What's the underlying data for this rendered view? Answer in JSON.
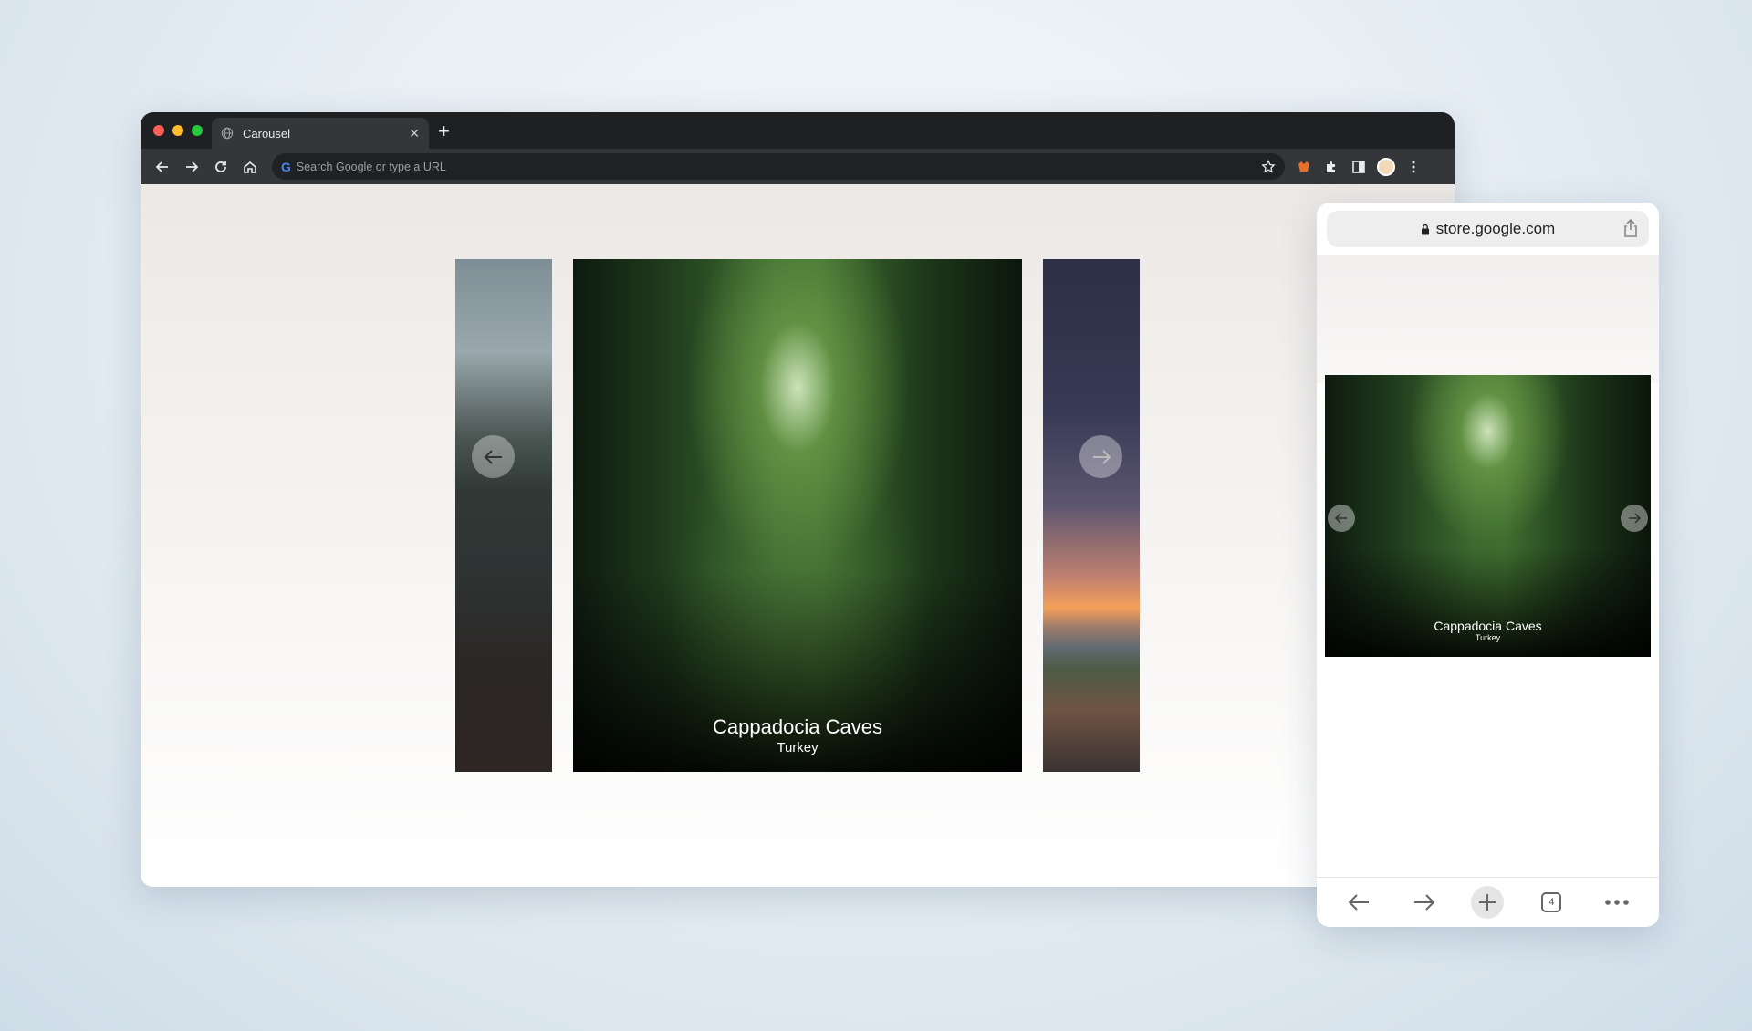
{
  "desktop": {
    "tab": {
      "title": "Carousel"
    },
    "omnibox": {
      "placeholder": "Search Google or type a URL"
    },
    "carousel": {
      "active_slide": {
        "title": "Cappadocia Caves",
        "subtitle": "Turkey"
      }
    }
  },
  "mobile": {
    "url": "store.google.com",
    "carousel": {
      "active_slide": {
        "title": "Cappadocia Caves",
        "subtitle": "Turkey"
      }
    },
    "tab_count": "4"
  },
  "colors": {
    "titlebar": "#1f2022",
    "toolbar": "#35363a",
    "omnibox": "#202124"
  },
  "icons": [
    "globe-icon",
    "close-icon",
    "plus-icon",
    "back-icon",
    "forward-icon",
    "reload-icon",
    "home-icon",
    "star-icon",
    "extension-icon",
    "puzzle-icon",
    "sidepanel-icon",
    "avatar",
    "kebab-icon",
    "lock-icon",
    "share-icon",
    "more-icon"
  ]
}
